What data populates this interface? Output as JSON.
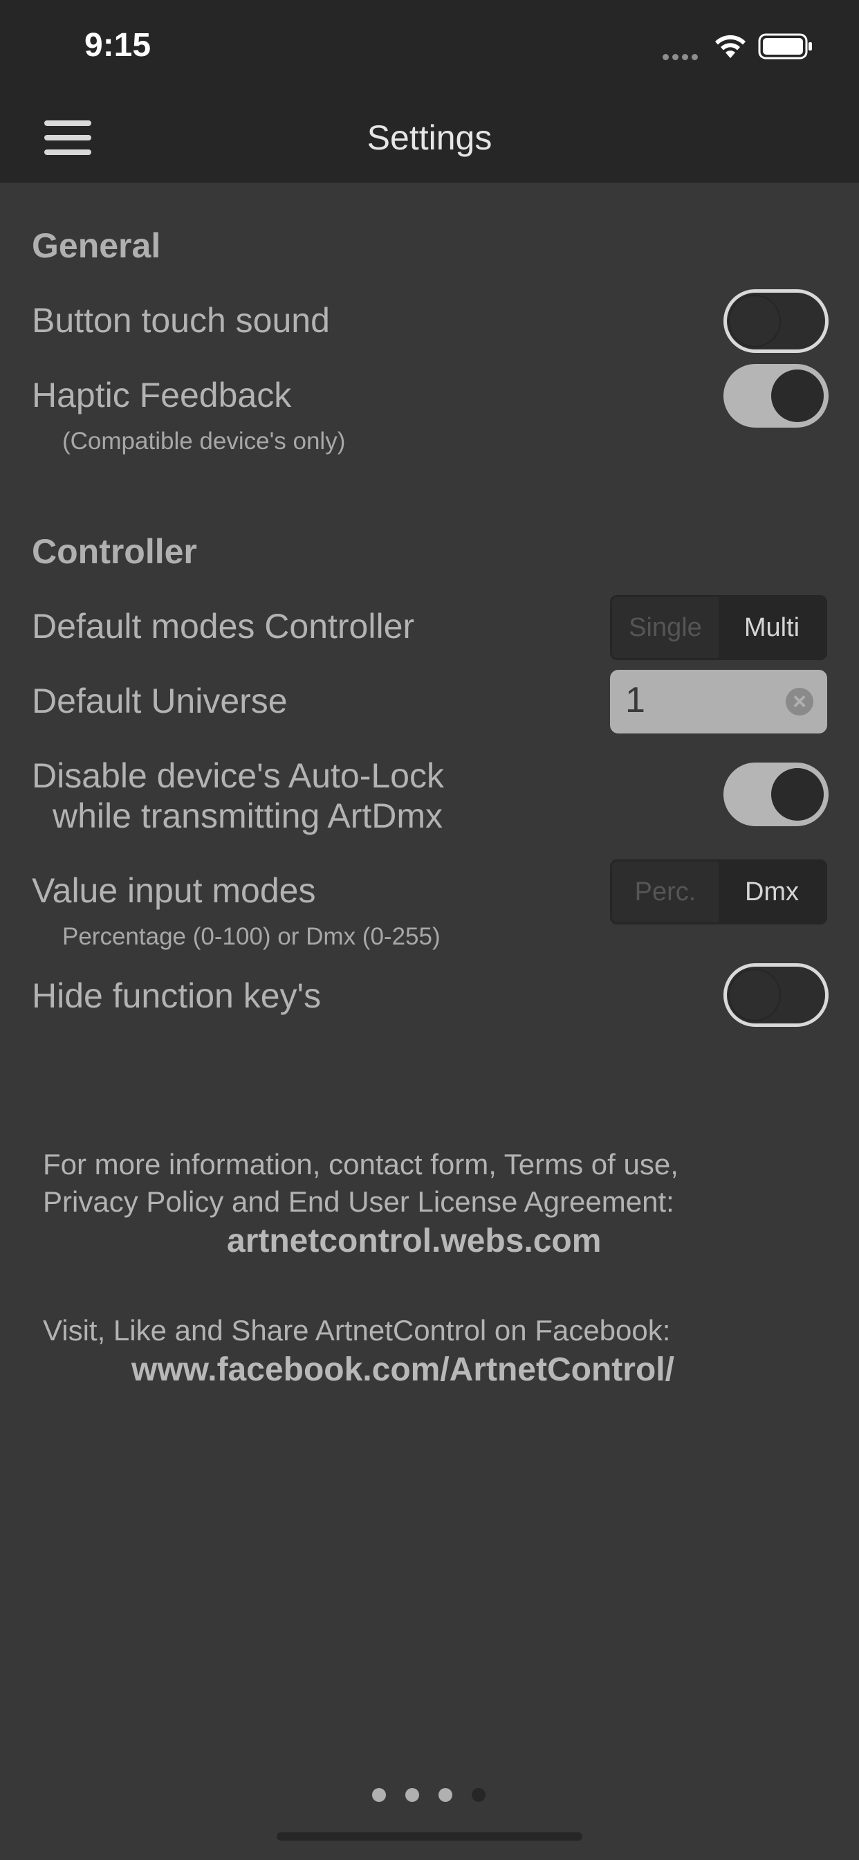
{
  "status_bar": {
    "time": "9:15"
  },
  "nav": {
    "title": "Settings"
  },
  "general": {
    "title": "General",
    "button_touch_sound": {
      "label": "Button touch sound",
      "on": false
    },
    "haptic_feedback": {
      "label": "Haptic Feedback",
      "note": "(Compatible device's only)",
      "on": true
    }
  },
  "controller": {
    "title": "Controller",
    "default_modes": {
      "label": "Default modes Controller",
      "options": [
        "Single",
        "Multi"
      ],
      "selected": "Multi"
    },
    "default_universe": {
      "label": "Default Universe",
      "value": "1"
    },
    "auto_lock": {
      "label_line1": "Disable device's Auto-Lock",
      "label_line2": "while transmitting ArtDmx",
      "on": true
    },
    "value_input": {
      "label": "Value input modes",
      "note": "Percentage (0-100) or Dmx (0-255)",
      "options": [
        "Perc.",
        "Dmx"
      ],
      "selected": "Dmx"
    },
    "hide_function_keys": {
      "label": "Hide function key's",
      "on": false
    }
  },
  "info": {
    "line1": "For more information, contact form, Terms of use,",
    "line2": "Privacy Policy and End User License Agreement:",
    "website": "artnetcontrol.webs.com",
    "facebook_text": "Visit, Like and Share ArtnetControl on Facebook:",
    "facebook_url": "www.facebook.com/ArtnetControl/"
  },
  "pager": {
    "pages": 4,
    "current": 4
  },
  "colors": {
    "background": "#383838",
    "bar": "#262626",
    "text": "#b3b3b3",
    "toggle_on": "#b5b5b5"
  }
}
